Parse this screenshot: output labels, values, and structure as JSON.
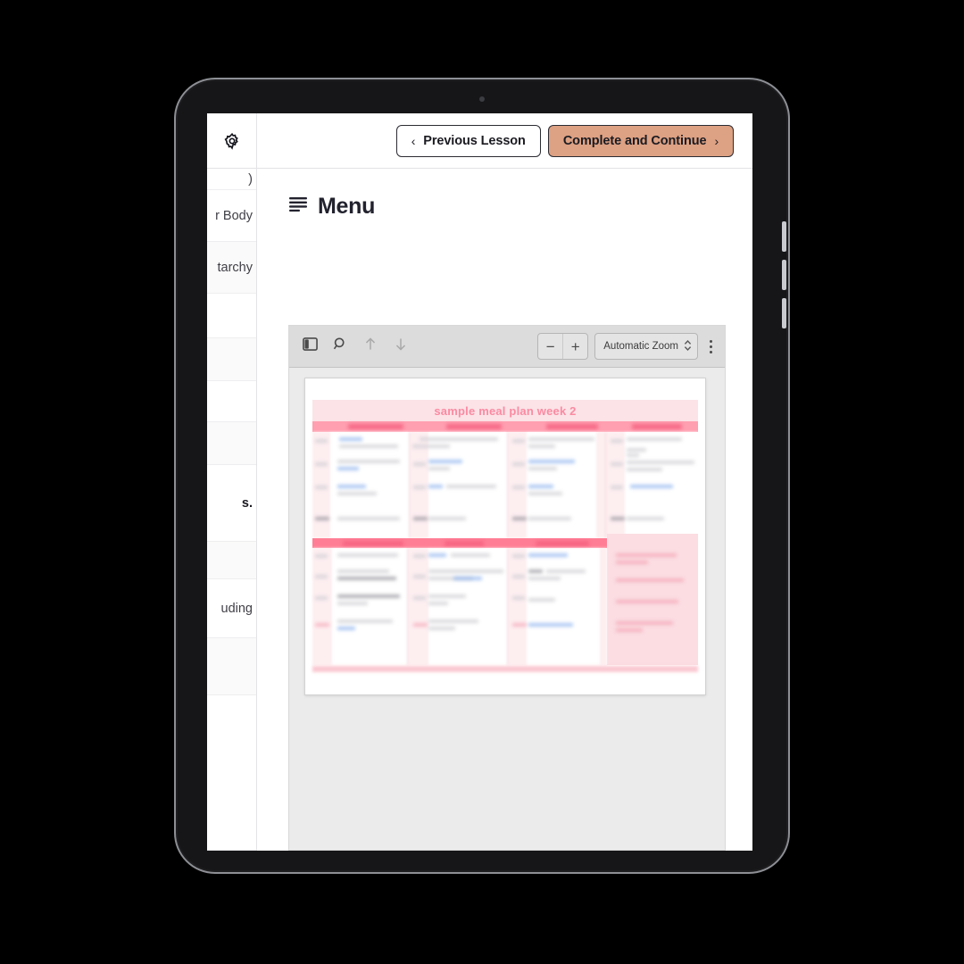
{
  "device": {
    "type": "tablet",
    "orientation": "portrait",
    "camera": "front-camera-dot",
    "side_buttons": [
      "volume-up",
      "volume-down",
      "power"
    ]
  },
  "topbar": {
    "settings_icon": "gear-icon",
    "prev_label": "Previous Lesson",
    "prev_chevron": "‹",
    "next_label": "Complete and Continue",
    "next_chevron": "›",
    "next_bg": "#dda183",
    "border_color": "#2b2b33"
  },
  "sidebar": {
    "note": "course curriculum list, horizontally clipped at the left screen edge",
    "items": [
      {
        "fragment": ")",
        "bold": false,
        "alt": false
      },
      {
        "fragment": "r Body",
        "bold": false,
        "alt": false
      },
      {
        "fragment": "tarchy",
        "bold": false,
        "alt": true
      },
      {
        "fragment": "",
        "bold": false,
        "alt": false
      },
      {
        "fragment": "",
        "bold": false,
        "alt": true
      },
      {
        "fragment": "",
        "bold": false,
        "alt": false
      },
      {
        "fragment": "",
        "bold": false,
        "alt": true
      },
      {
        "fragment": "s.",
        "bold": true,
        "alt": false
      },
      {
        "fragment": "",
        "bold": false,
        "alt": true
      },
      {
        "fragment": "uding",
        "bold": false,
        "alt": false
      },
      {
        "fragment": "",
        "bold": false,
        "alt": true
      },
      {
        "fragment": "",
        "bold": false,
        "alt": false
      }
    ]
  },
  "main": {
    "menu_icon": "menu-lines-icon",
    "menu_title": "Menu"
  },
  "pdf_viewer": {
    "toolbar": {
      "sidebar_toggle": "sidebar-toggle-icon",
      "find": "search-icon",
      "page_up": "arrow-up-icon",
      "page_down": "arrow-down-icon",
      "zoom_out": "−",
      "zoom_in": "+",
      "zoom_level": "Automatic Zoom",
      "zoom_stepper": "chevron-updown-icon",
      "more_tools": "vertical-dots-icon"
    },
    "document": {
      "title": "sample meal plan week 2",
      "title_color": "#fb8aa2",
      "content_state": "blurred",
      "layout": "two stacked tables; top table has 4 columns, lower table has 3 columns plus a tinted side panel",
      "page_background": "#ffffff",
      "viewer_background": "#ebebeb"
    }
  }
}
